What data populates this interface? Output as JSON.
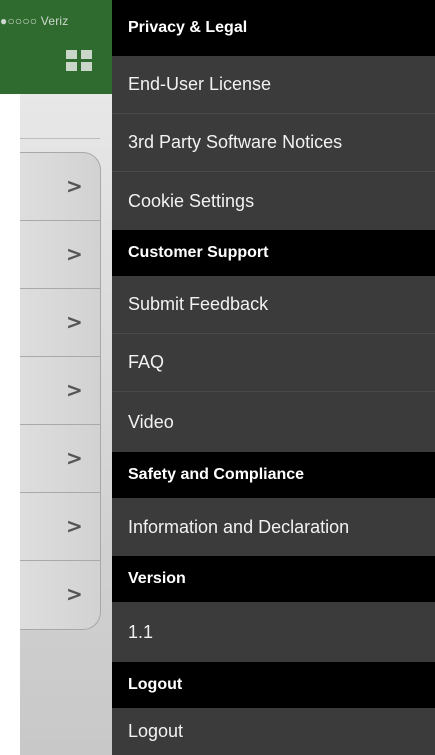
{
  "status_bar": {
    "carrier": "●○○○○ Veriz"
  },
  "colors": {
    "drawer_background": "#3b3b3b",
    "section_header_background": "#000000",
    "app_header_green": "#2f6b2f",
    "battery_green": "#4cd964"
  },
  "icons": {
    "grid": "grid-icon",
    "chevron": "chevron-right-icon"
  },
  "menu": {
    "privacy_header": "Privacy  & Legal",
    "end_user_license": "End-User License",
    "third_party_notices": "3rd Party Software Notices",
    "cookie_settings": "Cookie Settings",
    "support_header": "Customer Support",
    "submit_feedback": "Submit Feedback",
    "faq": "FAQ",
    "video": "Video",
    "safety_header": "Safety and Compliance",
    "information_declaration": "Information and Declaration",
    "version_header": "Version",
    "version_value": "1.1",
    "logout_header": "Logout",
    "logout": "Logout"
  },
  "background_rows": [
    ">",
    ">",
    ">",
    ">",
    ">",
    ">",
    ">"
  ]
}
